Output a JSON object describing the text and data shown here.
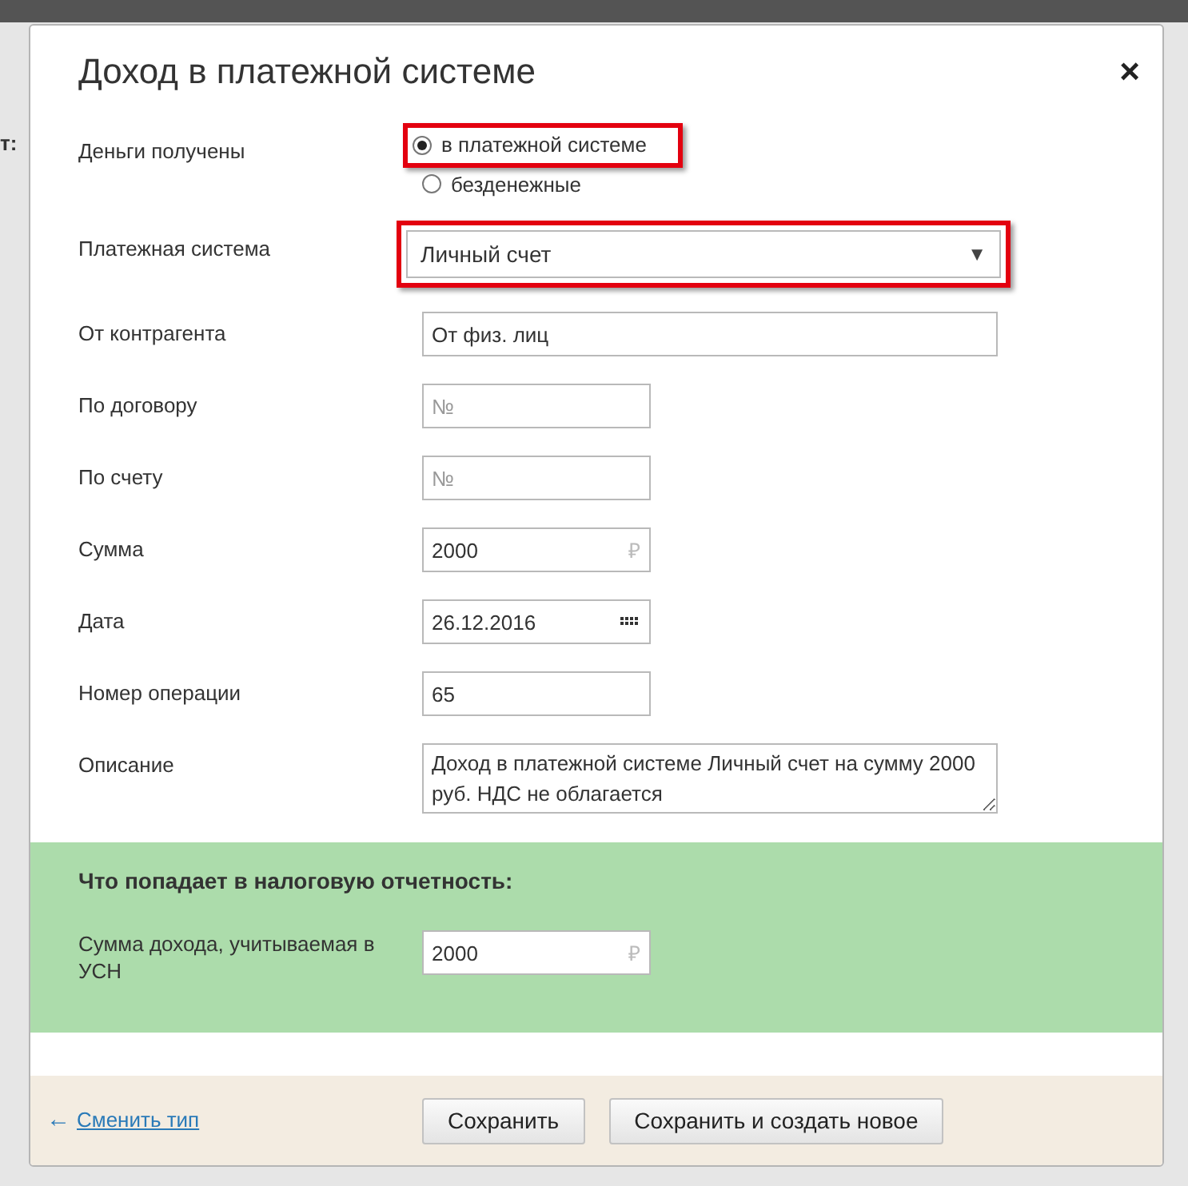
{
  "background": {
    "left_fragments": [
      "т:"
    ]
  },
  "dialog": {
    "title": "Доход в платежной системе",
    "close": "×",
    "fields": [
      {
        "kind": "radio",
        "label": "Деньги получены",
        "options": [
          {
            "label": "в платежной системе",
            "selected": true,
            "highlighted": true
          },
          {
            "label": "безденежные",
            "selected": false,
            "highlighted": false
          }
        ]
      },
      {
        "kind": "select",
        "label": "Платежная система",
        "value": "Личный счет",
        "arrow": "▼",
        "highlighted": true
      },
      {
        "kind": "text",
        "label": "От контрагента",
        "value": "От физ. лиц",
        "wide": true
      },
      {
        "kind": "text",
        "label": "По договору",
        "placeholder": "№"
      },
      {
        "kind": "text",
        "label": "По счету",
        "placeholder": "№"
      },
      {
        "kind": "money",
        "label": "Сумма",
        "value": "2000",
        "currency": "₽"
      },
      {
        "kind": "date",
        "label": "Дата",
        "value": "26.12.2016"
      },
      {
        "kind": "text",
        "label": "Номер операции",
        "value": "65"
      },
      {
        "kind": "textarea",
        "label": "Описание",
        "value": "Доход в платежной системе Личный счет на сумму 2000 руб. НДС не облагается"
      }
    ],
    "tax_section": {
      "title": "Что попадает в налоговую отчетность:",
      "label": "Сумма дохода, учитываемая в УСН",
      "value": "2000",
      "currency": "₽"
    },
    "footer": {
      "back_link": {
        "arrow": "←",
        "label": "Сменить тип"
      },
      "buttons": [
        "Сохранить",
        "Сохранить и создать новое"
      ]
    }
  }
}
